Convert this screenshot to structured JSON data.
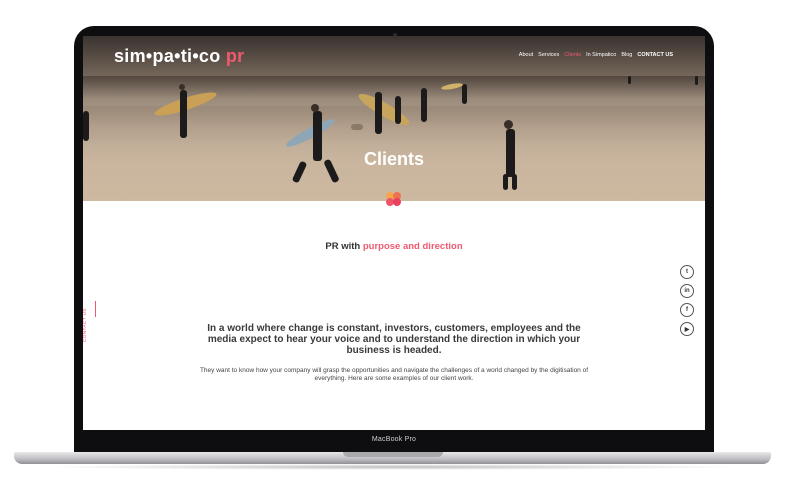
{
  "device": {
    "label": "MacBook Pro"
  },
  "site": {
    "logo": {
      "main": "sim•pa•ti•co",
      "accent": "pr"
    },
    "nav": [
      {
        "label": "About"
      },
      {
        "label": "Services"
      },
      {
        "label": "Clients",
        "active": true
      },
      {
        "label": "In Simpatico"
      },
      {
        "label": "Blog"
      },
      {
        "label": "CONTACT US"
      }
    ],
    "hero_title": "Clients",
    "tagline": {
      "prefix": "PR with",
      "highlight": "purpose and direction"
    },
    "side_contact": "CONTACT US",
    "social": [
      {
        "icon": "twitter-icon",
        "glyph": "t"
      },
      {
        "icon": "linkedin-icon",
        "glyph": "in"
      },
      {
        "icon": "facebook-icon",
        "glyph": "f"
      },
      {
        "icon": "youtube-icon",
        "glyph": "▶"
      }
    ],
    "heading": "In a world where change is constant, investors, customers, employees and the media expect to hear your voice and to understand the direction in which your business is headed.",
    "paragraph": "They want to know how your company will grasp the opportunities and navigate the challenges of a world changed by the digitisation of everything. Here are some examples of our client work."
  },
  "colors": {
    "accent": "#ef5a6f",
    "text": "#3a3a3a",
    "bezel": "#0e0e10"
  }
}
